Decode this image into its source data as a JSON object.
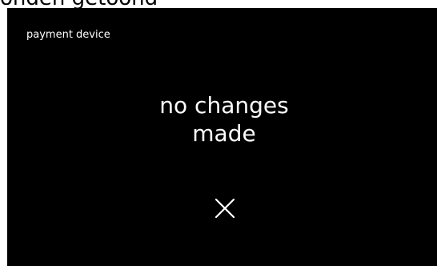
{
  "overlay_text": "onden getoond",
  "dialog": {
    "title": "payment device",
    "message_line1": "no changes",
    "message_line2": "made",
    "close_icon": "close-icon"
  },
  "colors": {
    "background": "#000000",
    "text": "#ffffff"
  }
}
